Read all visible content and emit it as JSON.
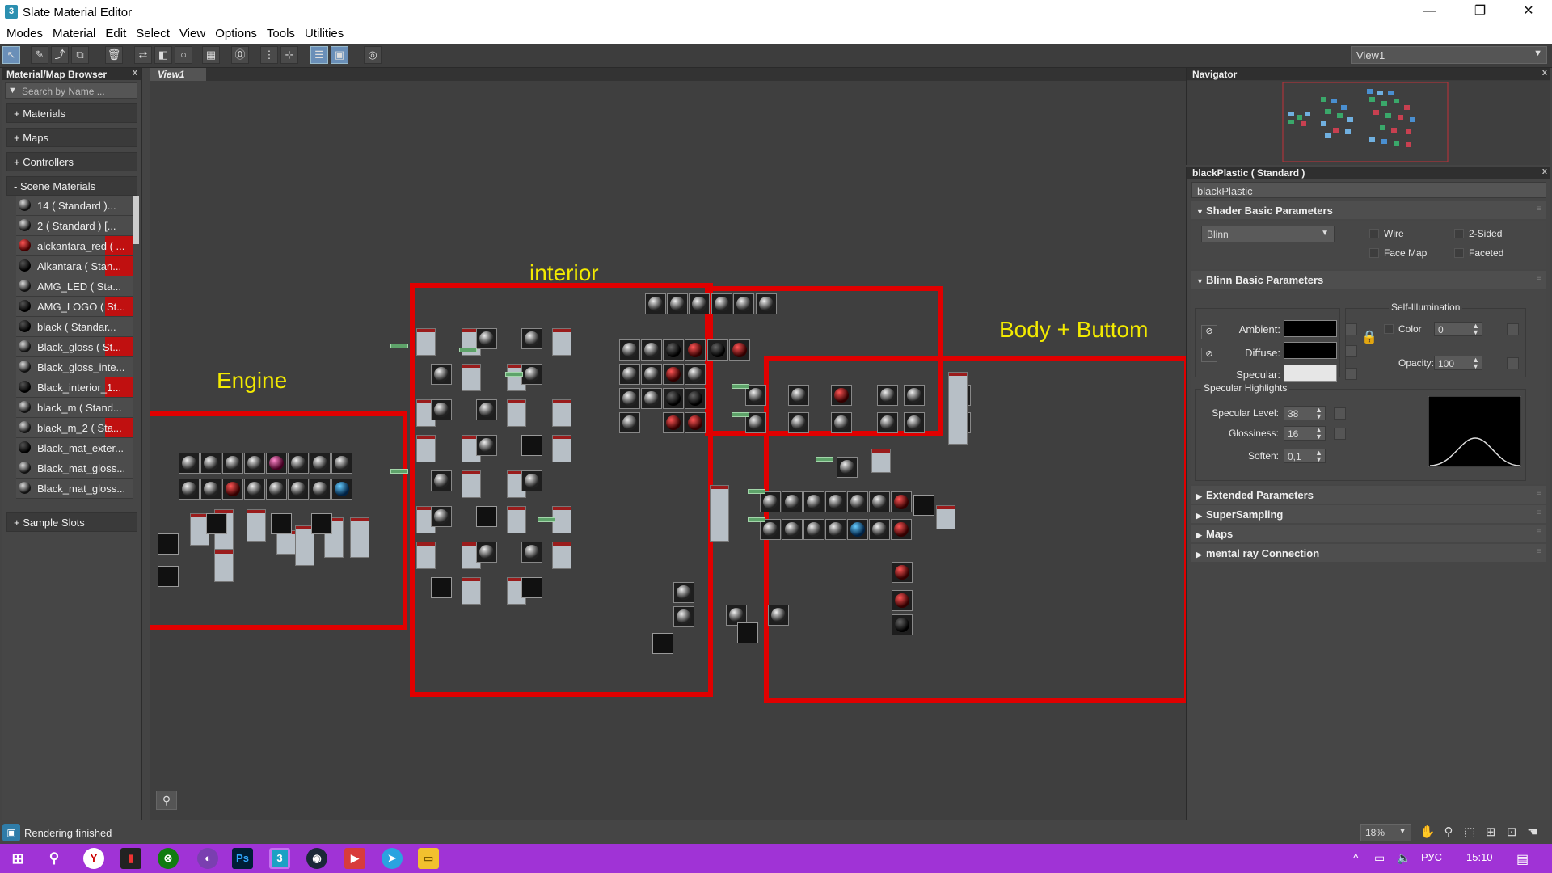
{
  "window": {
    "title": "Slate Material Editor",
    "app_icon": "3",
    "controls": {
      "minimize": "—",
      "maximize": "❐",
      "close": "✕"
    }
  },
  "menu": [
    "Modes",
    "Material",
    "Edit",
    "Select",
    "View",
    "Options",
    "Tools",
    "Utilities"
  ],
  "toolbar": {
    "view_select": "View1",
    "icons": [
      "select-tool-icon",
      "eyedropper-icon",
      "put-to-scene-icon",
      "assign-icon",
      "delete-icon",
      "move-children-icon",
      "hide-unused-icon",
      "background-icon",
      "checker-icon",
      "show-map-icon",
      "layout-all-icon",
      "layout-children-icon",
      "material-map-browser-icon",
      "parameter-editor-icon",
      "select-by-material-icon"
    ]
  },
  "browser": {
    "title": "Material/Map Browser",
    "close": "x",
    "search_placeholder": "Search by Name ...",
    "sections": {
      "materials": "+ Materials",
      "maps": "+ Maps",
      "controllers": "+ Controllers",
      "scene_materials": "- Scene Materials",
      "sample_slots": "+ Sample Slots"
    },
    "scene_items": [
      {
        "label": "14  ( Standard )...",
        "ball": "light",
        "red": false
      },
      {
        "label": "2  ( Standard )  [...",
        "ball": "light",
        "red": false
      },
      {
        "label": "alckantara_red  ( ...",
        "ball": "red",
        "red": true
      },
      {
        "label": "Alkantara  ( Stan...",
        "ball": "dark",
        "red": true
      },
      {
        "label": "AMG_LED  ( Sta...",
        "ball": "light",
        "red": false
      },
      {
        "label": "AMG_LOGO  ( St...",
        "ball": "dark",
        "red": true
      },
      {
        "label": "black  ( Standar...",
        "ball": "dark",
        "red": false
      },
      {
        "label": "Black_gloss  ( St...",
        "ball": "light",
        "red": true
      },
      {
        "label": "Black_gloss_inte...",
        "ball": "light",
        "red": false
      },
      {
        "label": "Black_interior_1...",
        "ball": "dark",
        "red": true
      },
      {
        "label": "black_m  ( Stand...",
        "ball": "light",
        "red": false
      },
      {
        "label": "black_m_2  ( Sta...",
        "ball": "light",
        "red": true
      },
      {
        "label": "Black_mat_exter...",
        "ball": "dark",
        "red": false
      },
      {
        "label": "Black_mat_gloss...",
        "ball": "light",
        "red": false
      },
      {
        "label": "Black_mat_gloss...",
        "ball": "light",
        "red": false
      }
    ]
  },
  "view": {
    "tab": "View1",
    "groups": {
      "engine": "Engine",
      "interior": "interior",
      "body": "Body + Buttom"
    }
  },
  "navigator": {
    "title": "Navigator",
    "close": "x"
  },
  "props": {
    "header": "blackPlastic  ( Standard )",
    "close": "x",
    "material_name": "blackPlastic",
    "shader": {
      "title": "Shader Basic Parameters",
      "type": "Blinn",
      "wire": "Wire",
      "two_sided": "2-Sided",
      "face_map": "Face Map",
      "faceted": "Faceted"
    },
    "blinn": {
      "title": "Blinn Basic Parameters",
      "self_illum": "Self-Illumination",
      "color": "Color",
      "color_value": "0",
      "ambient": "Ambient:",
      "diffuse": "Diffuse:",
      "specular": "Specular:",
      "opacity": "Opacity:",
      "opacity_value": "100",
      "ambient_color": "#000000",
      "diffuse_color": "#000000",
      "specular_color": "#e6e6e6",
      "highlights": "Specular Highlights",
      "spec_level": "Specular Level:",
      "spec_level_value": "38",
      "glossiness": "Glossiness:",
      "glossiness_value": "16",
      "soften": "Soften:",
      "soften_value": "0,1"
    },
    "rollouts": [
      "Extended Parameters",
      "SuperSampling",
      "Maps",
      "mental ray Connection"
    ]
  },
  "status": {
    "text": "Rendering finished",
    "zoom": "18%"
  },
  "tray": {
    "lang": "РУС",
    "time": "15:10"
  },
  "colors": {
    "group_outline": "#e00000",
    "group_label": "#f3ea00",
    "taskbar": "#a033d6"
  }
}
